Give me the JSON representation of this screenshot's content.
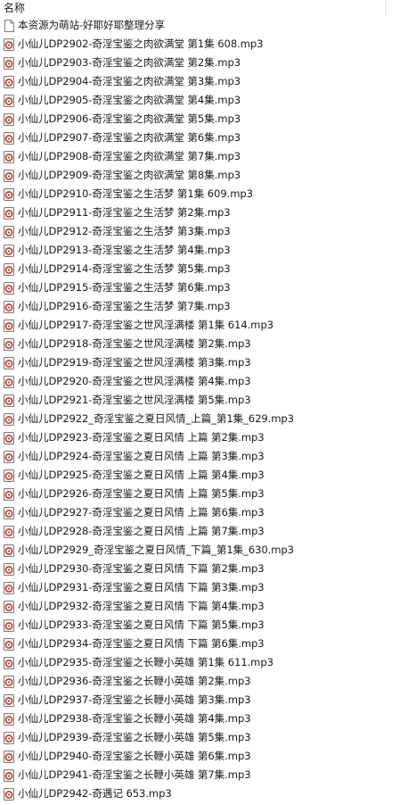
{
  "header": {
    "name_column": "名称"
  },
  "files": [
    {
      "name": "本资源为萌站-好耶好耶整理分享",
      "icon": "document-icon"
    },
    {
      "name": "小仙儿DP2902-奇淫宝鉴之肉欲满堂 第1集 608.mp3",
      "icon": "audio-file-icon"
    },
    {
      "name": "小仙儿DP2903-奇淫宝鉴之肉欲满堂 第2集.mp3",
      "icon": "audio-file-icon"
    },
    {
      "name": "小仙儿DP2904-奇淫宝鉴之肉欲满堂 第3集.mp3",
      "icon": "audio-file-icon"
    },
    {
      "name": "小仙儿DP2905-奇淫宝鉴之肉欲满堂 第4集.mp3",
      "icon": "audio-file-icon"
    },
    {
      "name": "小仙儿DP2906-奇淫宝鉴之肉欲满堂 第5集.mp3",
      "icon": "audio-file-icon"
    },
    {
      "name": "小仙儿DP2907-奇淫宝鉴之肉欲满堂 第6集.mp3",
      "icon": "audio-file-icon"
    },
    {
      "name": "小仙儿DP2908-奇淫宝鉴之肉欲满堂 第7集.mp3",
      "icon": "audio-file-icon"
    },
    {
      "name": "小仙儿DP2909-奇淫宝鉴之肉欲满堂 第8集.mp3",
      "icon": "audio-file-icon"
    },
    {
      "name": "小仙儿DP2910-奇淫宝鉴之生活梦 第1集 609.mp3",
      "icon": "audio-file-icon"
    },
    {
      "name": "小仙儿DP2911-奇淫宝鉴之生活梦 第2集.mp3",
      "icon": "audio-file-icon"
    },
    {
      "name": "小仙儿DP2912-奇淫宝鉴之生活梦 第3集.mp3",
      "icon": "audio-file-icon"
    },
    {
      "name": "小仙儿DP2913-奇淫宝鉴之生活梦 第4集.mp3",
      "icon": "audio-file-icon"
    },
    {
      "name": "小仙儿DP2914-奇淫宝鉴之生活梦 第5集.mp3",
      "icon": "audio-file-icon"
    },
    {
      "name": "小仙儿DP2915-奇淫宝鉴之生活梦 第6集.mp3",
      "icon": "audio-file-icon"
    },
    {
      "name": "小仙儿DP2916-奇淫宝鉴之生活梦 第7集.mp3",
      "icon": "audio-file-icon"
    },
    {
      "name": "小仙儿DP2917-奇淫宝鉴之世风淫满楼 第1集 614.mp3",
      "icon": "audio-file-icon"
    },
    {
      "name": "小仙儿DP2918-奇淫宝鉴之世风淫满楼 第2集.mp3",
      "icon": "audio-file-icon"
    },
    {
      "name": "小仙儿DP2919-奇淫宝鉴之世风淫满楼 第3集.mp3",
      "icon": "audio-file-icon"
    },
    {
      "name": "小仙儿DP2920-奇淫宝鉴之世风淫满楼 第4集.mp3",
      "icon": "audio-file-icon"
    },
    {
      "name": "小仙儿DP2921-奇淫宝鉴之世风淫满楼 第5集.mp3",
      "icon": "audio-file-icon"
    },
    {
      "name": "小仙儿DP2922_奇淫宝鉴之夏日风情_上篇_第1集_629.mp3",
      "icon": "audio-file-icon"
    },
    {
      "name": "小仙儿DP2923-奇淫宝鉴之夏日风情 上篇 第2集.mp3",
      "icon": "audio-file-icon"
    },
    {
      "name": "小仙儿DP2924-奇淫宝鉴之夏日风情 上篇 第3集.mp3",
      "icon": "audio-file-icon"
    },
    {
      "name": "小仙儿DP2925-奇淫宝鉴之夏日风情 上篇 第4集.mp3",
      "icon": "audio-file-icon"
    },
    {
      "name": "小仙儿DP2926-奇淫宝鉴之夏日风情 上篇 第5集.mp3",
      "icon": "audio-file-icon"
    },
    {
      "name": "小仙儿DP2927-奇淫宝鉴之夏日风情 上篇 第6集.mp3",
      "icon": "audio-file-icon"
    },
    {
      "name": "小仙儿DP2928-奇淫宝鉴之夏日风情 上篇 第7集.mp3",
      "icon": "audio-file-icon"
    },
    {
      "name": "小仙儿DP2929_奇淫宝鉴之夏日风情_下篇_第1集_630.mp3",
      "icon": "audio-file-icon"
    },
    {
      "name": "小仙儿DP2930-奇淫宝鉴之夏日风情 下篇 第2集.mp3",
      "icon": "audio-file-icon"
    },
    {
      "name": "小仙儿DP2931-奇淫宝鉴之夏日风情 下篇 第3集.mp3",
      "icon": "audio-file-icon"
    },
    {
      "name": "小仙儿DP2932-奇淫宝鉴之夏日风情 下篇 第4集.mp3",
      "icon": "audio-file-icon"
    },
    {
      "name": "小仙儿DP2933-奇淫宝鉴之夏日风情 下篇 第5集.mp3",
      "icon": "audio-file-icon"
    },
    {
      "name": "小仙儿DP2934-奇淫宝鉴之夏日风情 下篇 第6集.mp3",
      "icon": "audio-file-icon"
    },
    {
      "name": "小仙儿DP2935-奇淫宝鉴之长鞭小英雄 第1集 611.mp3",
      "icon": "audio-file-icon"
    },
    {
      "name": "小仙儿DP2936-奇淫宝鉴之长鞭小英雄 第2集.mp3",
      "icon": "audio-file-icon"
    },
    {
      "name": "小仙儿DP2937-奇淫宝鉴之长鞭小英雄 第3集.mp3",
      "icon": "audio-file-icon"
    },
    {
      "name": "小仙儿DP2938-奇淫宝鉴之长鞭小英雄 第4集.mp3",
      "icon": "audio-file-icon"
    },
    {
      "name": "小仙儿DP2939-奇淫宝鉴之长鞭小英雄 第5集.mp3",
      "icon": "audio-file-icon"
    },
    {
      "name": "小仙儿DP2940-奇淫宝鉴之长鞭小英雄 第6集.mp3",
      "icon": "audio-file-icon"
    },
    {
      "name": "小仙儿DP2941-奇淫宝鉴之长鞭小英雄 第7集.mp3",
      "icon": "audio-file-icon"
    },
    {
      "name": "小仙儿DP2942-奇遇记 653.mp3",
      "icon": "audio-file-icon"
    }
  ],
  "colors": {
    "text": "#1a1a1a",
    "audio_icon_accent": "#c0392b",
    "icon_outline": "#7a7a7a",
    "header_divider": "#e5e5e5"
  }
}
